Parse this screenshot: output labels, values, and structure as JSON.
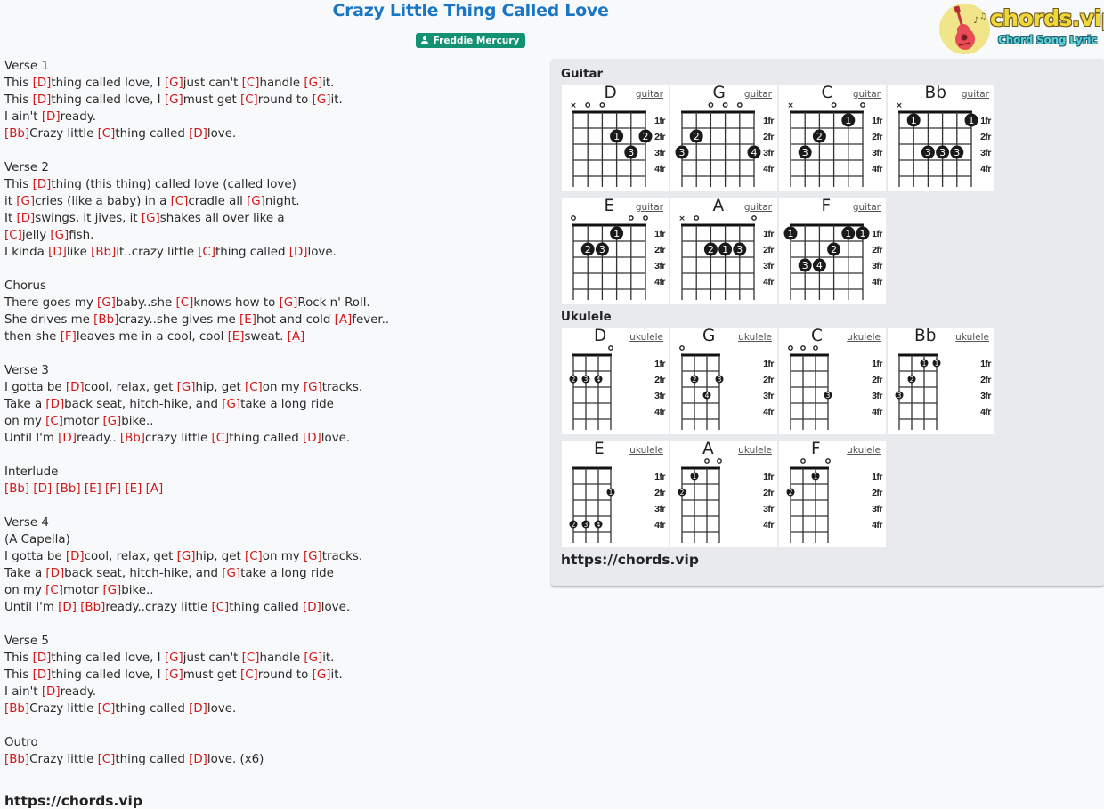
{
  "header": {
    "title": "Crazy Little Thing Called Love",
    "artist": "Freddie Mercury",
    "artist_icon": "person-icon"
  },
  "logo": {
    "text": "chords.vip",
    "subtitle": "Chord Song Lyric",
    "icon": "guitar-icon",
    "colors": {
      "circle": "#f1e58a",
      "text": "#f2d73a",
      "subtitle": "#5fd3d6"
    }
  },
  "colors": {
    "title": "#1a76c4",
    "badge": "#139173",
    "chord": "#d01818",
    "panel": "#e8eaed"
  },
  "lyrics": [
    {
      "section": "Verse 1",
      "lines": [
        [
          "This ",
          "[D]",
          "thing called love, I ",
          "[G]",
          "just can't ",
          "[C]",
          "handle ",
          "[G]",
          "it."
        ],
        [
          "This ",
          "[D]",
          "thing called love, I ",
          "[G]",
          "must get ",
          "[C]",
          "round to ",
          "[G]",
          "it."
        ],
        [
          "I ain't ",
          "[D]",
          "ready."
        ],
        [
          "",
          "[Bb]",
          "Crazy little ",
          "[C]",
          "thing called ",
          "[D]",
          "love."
        ]
      ]
    },
    {
      "section": "Verse 2",
      "lines": [
        [
          "This ",
          "[D]",
          "thing (this thing) called love (called love)"
        ],
        [
          "it ",
          "[G]",
          "cries (like a baby) in a ",
          "[C]",
          "cradle all ",
          "[G]",
          "night."
        ],
        [
          "It ",
          "[D]",
          "swings, it jives, it ",
          "[G]",
          "shakes all over like a"
        ],
        [
          "",
          "[C]",
          "jelly ",
          "[G]",
          "fish."
        ],
        [
          "I kinda ",
          "[D]",
          "like ",
          "[Bb]",
          "it..crazy little ",
          "[C]",
          "thing called ",
          "[D]",
          "love."
        ]
      ]
    },
    {
      "section": "Chorus",
      "lines": [
        [
          "There goes my ",
          "[G]",
          "baby..she ",
          "[C]",
          "knows how to ",
          "[G]",
          "Rock n' Roll."
        ],
        [
          "She drives me ",
          "[Bb]",
          "crazy..she gives me ",
          "[E]",
          "hot and cold ",
          "[A]",
          "fever.."
        ],
        [
          "then she ",
          "[F]",
          "leaves me in a cool, cool ",
          "[E]",
          "sweat. ",
          "[A]"
        ]
      ]
    },
    {
      "section": "Verse 3",
      "lines": [
        [
          "I gotta be ",
          "[D]",
          "cool, relax, get ",
          "[G]",
          "hip, get ",
          "[C]",
          "on my ",
          "[G]",
          "tracks."
        ],
        [
          "Take a ",
          "[D]",
          "back seat, hitch-hike, and ",
          "[G]",
          "take a long ride"
        ],
        [
          "on my ",
          "[C]",
          "motor ",
          "[G]",
          "bike.."
        ],
        [
          "Until I'm ",
          "[D]",
          "ready.. ",
          "[Bb]",
          "crazy little ",
          "[C]",
          "thing called ",
          "[D]",
          "love."
        ]
      ]
    },
    {
      "section": "Interlude",
      "lines": [
        [
          "",
          "[Bb]",
          " ",
          "[D]",
          " ",
          "[Bb]",
          " ",
          "[E]",
          " ",
          "[F]",
          " ",
          "[E]",
          " ",
          "[A]"
        ]
      ]
    },
    {
      "section": "Verse 4",
      "lines": [
        [
          "(A Capella)"
        ],
        [
          "I gotta be ",
          "[D]",
          "cool, relax, get ",
          "[G]",
          "hip, get ",
          "[C]",
          "on my ",
          "[G]",
          "tracks."
        ],
        [
          "Take a ",
          "[D]",
          "back seat, hitch-hike, and ",
          "[G]",
          "take a long ride"
        ],
        [
          "on my ",
          "[C]",
          "motor ",
          "[G]",
          "bike.."
        ],
        [
          "Until I'm ",
          "[D]",
          " ",
          "[Bb]",
          "ready..crazy little ",
          "[C]",
          "thing called ",
          "[D]",
          "love."
        ]
      ]
    },
    {
      "section": "Verse 5",
      "lines": [
        [
          "This ",
          "[D]",
          "thing called love, I ",
          "[G]",
          "just can't ",
          "[C]",
          "handle ",
          "[G]",
          "it."
        ],
        [
          "This ",
          "[D]",
          "thing called love, I ",
          "[G]",
          "must get ",
          "[C]",
          "round to ",
          "[G]",
          "it."
        ],
        [
          "I ain't ",
          "[D]",
          "ready."
        ],
        [
          "",
          "[Bb]",
          "Crazy little ",
          "[C]",
          "thing called ",
          "[D]",
          "love."
        ]
      ]
    },
    {
      "section": "Outro",
      "lines": [
        [
          "",
          "[Bb]",
          "Crazy little ",
          "[C]",
          "thing called ",
          "[D]",
          "love. (x6)"
        ]
      ]
    }
  ],
  "site_url": "https://chords.vip",
  "chord_panel": {
    "fret_labels": [
      "1fr",
      "2fr",
      "3fr",
      "4fr"
    ],
    "url": "https://chords.vip",
    "guitar": {
      "heading": "Guitar",
      "instrument_label": "guitar",
      "strings": 6,
      "chords": [
        {
          "name": "D",
          "markers": [
            "x",
            "o",
            "o",
            "",
            "",
            ""
          ],
          "dots": [
            [
              4,
              2,
              "1"
            ],
            [
              6,
              2,
              "2"
            ],
            [
              5,
              3,
              "3"
            ]
          ]
        },
        {
          "name": "G",
          "markers": [
            "",
            "",
            "o",
            "o",
            "o",
            ""
          ],
          "dots": [
            [
              2,
              2,
              "2"
            ],
            [
              1,
              3,
              "3"
            ],
            [
              6,
              3,
              "4"
            ]
          ]
        },
        {
          "name": "C",
          "markers": [
            "x",
            "",
            "",
            "o",
            "",
            "o"
          ],
          "dots": [
            [
              5,
              1,
              "1"
            ],
            [
              3,
              2,
              "2"
            ],
            [
              2,
              3,
              "3"
            ]
          ]
        },
        {
          "name": "Bb",
          "markers": [
            "x",
            "",
            "",
            "",
            "",
            ""
          ],
          "dots": [
            [
              2,
              1,
              "1"
            ],
            [
              6,
              1,
              "1"
            ],
            [
              3,
              3,
              "3"
            ],
            [
              4,
              3,
              "3"
            ],
            [
              5,
              3,
              "3"
            ]
          ]
        },
        {
          "name": "E",
          "markers": [
            "o",
            "",
            "",
            "",
            "o",
            "o"
          ],
          "dots": [
            [
              4,
              1,
              "1"
            ],
            [
              2,
              2,
              "2"
            ],
            [
              3,
              2,
              "3"
            ]
          ]
        },
        {
          "name": "A",
          "markers": [
            "x",
            "o",
            "",
            "",
            "",
            "o"
          ],
          "dots": [
            [
              3,
              2,
              "2"
            ],
            [
              4,
              2,
              "1"
            ],
            [
              5,
              2,
              "3"
            ]
          ]
        },
        {
          "name": "F",
          "markers": [
            "",
            "",
            "",
            "",
            "",
            ""
          ],
          "dots": [
            [
              1,
              1,
              "1"
            ],
            [
              5,
              1,
              "1"
            ],
            [
              6,
              1,
              "1"
            ],
            [
              4,
              2,
              "2"
            ],
            [
              2,
              3,
              "3"
            ],
            [
              3,
              3,
              "4"
            ]
          ]
        }
      ]
    },
    "ukulele": {
      "heading": "Ukulele",
      "instrument_label": "ukulele",
      "strings": 4,
      "chords": [
        {
          "name": "D",
          "markers": [
            "",
            "",
            "",
            "o"
          ],
          "dots": [
            [
              1,
              2,
              "2"
            ],
            [
              2,
              2,
              "3"
            ],
            [
              3,
              2,
              "4"
            ]
          ]
        },
        {
          "name": "G",
          "markers": [
            "o",
            "",
            "",
            ""
          ],
          "dots": [
            [
              2,
              2,
              "2"
            ],
            [
              4,
              2,
              "3"
            ],
            [
              3,
              3,
              "4"
            ]
          ]
        },
        {
          "name": "C",
          "markers": [
            "o",
            "o",
            "o",
            ""
          ],
          "dots": [
            [
              4,
              3,
              "3"
            ]
          ]
        },
        {
          "name": "Bb",
          "markers": [
            "",
            "",
            "",
            ""
          ],
          "dots": [
            [
              3,
              1,
              "1"
            ],
            [
              4,
              1,
              "1"
            ],
            [
              2,
              2,
              "2"
            ],
            [
              1,
              3,
              "3"
            ]
          ]
        },
        {
          "name": "E",
          "markers": [
            "",
            "",
            "",
            ""
          ],
          "dots": [
            [
              4,
              2,
              "1"
            ],
            [
              1,
              4,
              "2"
            ],
            [
              2,
              4,
              "3"
            ],
            [
              3,
              4,
              "4"
            ]
          ]
        },
        {
          "name": "A",
          "markers": [
            "",
            "",
            "o",
            "o"
          ],
          "dots": [
            [
              2,
              1,
              "1"
            ],
            [
              1,
              2,
              "2"
            ]
          ]
        },
        {
          "name": "F",
          "markers": [
            "",
            "o",
            "",
            "o"
          ],
          "dots": [
            [
              3,
              1,
              "1"
            ],
            [
              1,
              2,
              "2"
            ]
          ]
        }
      ]
    }
  }
}
